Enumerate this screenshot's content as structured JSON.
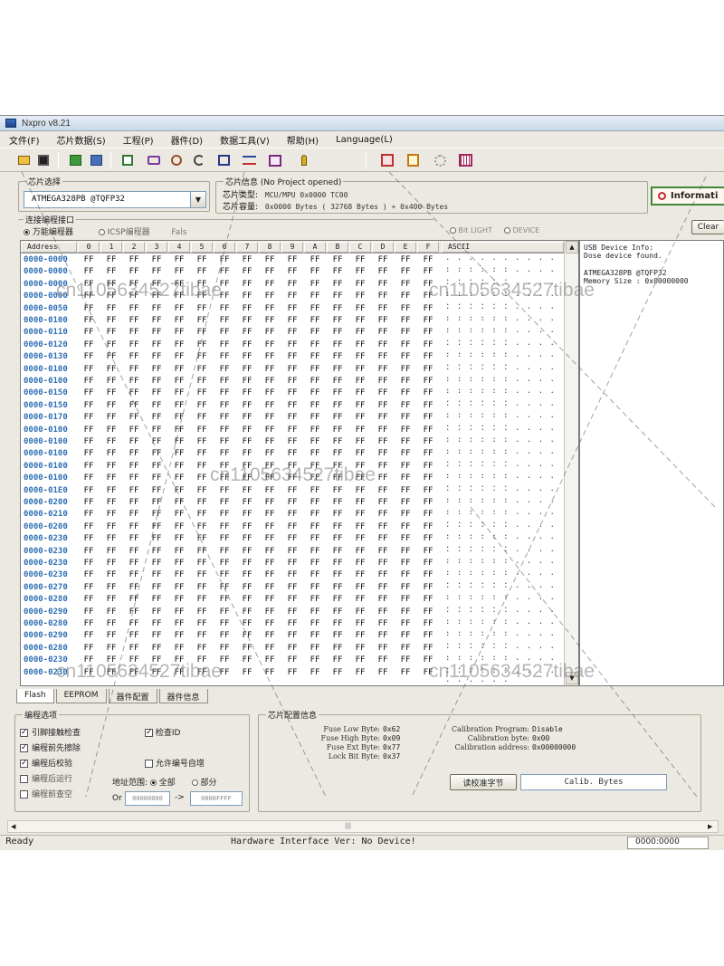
{
  "window": {
    "title": "Nxpro v8.21"
  },
  "menu": [
    "文件(F)",
    "芯片数据(S)",
    "工程(P)",
    "器件(D)",
    "数据工具(V)",
    "帮助(H)",
    "Language(L)"
  ],
  "toolbar_icons": [
    "open-icon",
    "save-icon",
    "load-project-icon",
    "save-project-icon",
    "program-icon",
    "read-icon",
    "verify-icon",
    "erase-icon",
    "blank-check-icon",
    "auto-icon",
    "lock-icon",
    "config-icon",
    "encrypt-icon",
    "memory-icon"
  ],
  "chip_select": {
    "title": "芯片选择",
    "value": "ATMEGA328PB @TQFP32"
  },
  "chip_info": {
    "title": "芯片信息 (No Project opened)",
    "type_label": "芯片类型:",
    "type_value": "MCU/MPU    0x0000 TC00",
    "size_label": "芯片容量:",
    "size_value": "0x0000 Bytes ( 32768 Bytes ) + 0x400 Bytes"
  },
  "info_button": {
    "label": "Informati"
  },
  "connection": {
    "title": "连接编程接口",
    "opt1": "万能编程器",
    "opt2": "ICSP编程器",
    "opt3": "Fals",
    "radio_a": "Bit LIGHT",
    "radio_b": "DEVICE"
  },
  "clear_label": "Clear",
  "hex": {
    "header_address": "Address",
    "header_ascii": "ASCII",
    "columns": [
      "0",
      "1",
      "2",
      "3",
      "4",
      "5",
      "6",
      "7",
      "8",
      "9",
      "A",
      "B",
      "C",
      "D",
      "E",
      "F"
    ],
    "rows": [
      {
        "addr": "0000-0000"
      },
      {
        "addr": "0000-0000"
      },
      {
        "addr": "0000-0000"
      },
      {
        "addr": "0000-0000"
      },
      {
        "addr": "0000-0050"
      },
      {
        "addr": "0000-0100"
      },
      {
        "addr": "0000-0110"
      },
      {
        "addr": "0000-0120"
      },
      {
        "addr": "0000-0130"
      },
      {
        "addr": "0000-0100"
      },
      {
        "addr": "0000-0100"
      },
      {
        "addr": "0000-0150"
      },
      {
        "addr": "0000-0150"
      },
      {
        "addr": "0000-0170"
      },
      {
        "addr": "0000-0100"
      },
      {
        "addr": "0000-0100"
      },
      {
        "addr": "0000-0100"
      },
      {
        "addr": "0000-0100"
      },
      {
        "addr": "0000-0100"
      },
      {
        "addr": "0000-01E0"
      },
      {
        "addr": "0000-0200"
      },
      {
        "addr": "0000-0210"
      },
      {
        "addr": "0000-0200"
      },
      {
        "addr": "0000-0230"
      },
      {
        "addr": "0000-0230"
      },
      {
        "addr": "0000-0230"
      },
      {
        "addr": "0000-0230"
      },
      {
        "addr": "0000-0270"
      },
      {
        "addr": "0000-0280"
      },
      {
        "addr": "0000-0290"
      },
      {
        "addr": "0000-0280"
      },
      {
        "addr": "0000-0290"
      },
      {
        "addr": "0000-0280"
      },
      {
        "addr": "0000-0230"
      },
      {
        "addr": "0000-0230"
      }
    ],
    "cell_value": "FF",
    "ascii_value": ". . . . . . . . . . . . . . . ."
  },
  "side_panel": {
    "line1": "USB Device Info:",
    "line2": "  Dose device found.",
    "line3": "ATMEGA328PB @TQFP32",
    "line4": "  Memory Size : 0x00000000"
  },
  "tabs": [
    "Flash",
    "EEPROM",
    "器件配置",
    "器件信息"
  ],
  "program_settings": {
    "title": "编程选项",
    "options": [
      {
        "label": "引脚接触检查",
        "checked": true
      },
      {
        "label": "编程前先擦除",
        "checked": true
      },
      {
        "label": "编程后校验",
        "checked": true
      },
      {
        "label": "编程后运行",
        "checked": false
      },
      {
        "label": "编程前查空",
        "checked": false
      }
    ],
    "opt_verify": "检查ID",
    "opt_serial": "允许编号自增",
    "range_label": "地址范围:",
    "range_all": "全部",
    "range_part": "部分",
    "range_or": "Or",
    "range_from": "00000000",
    "range_arrow": "->",
    "range_to": "0000FFFF"
  },
  "chip_config": {
    "title": "芯片配置信息",
    "rows_left": [
      {
        "k": "Fuse Low Byte:",
        "v": "0x62"
      },
      {
        "k": "Fuse High Byte:",
        "v": "0x09"
      },
      {
        "k": "Fuse Ext Byte:",
        "v": "0x77"
      },
      {
        "k": "Lock Bit Byte:",
        "v": "0x37"
      }
    ],
    "rows_right": [
      {
        "k": "Calibration Program:",
        "v": "Disable"
      },
      {
        "k": "Calibration byte:",
        "v": "0x00"
      },
      {
        "k": "Calibration address:",
        "v": "0x00000000"
      }
    ],
    "read_calib_button": "读校准字节",
    "calib_field": "Calib. Bytes"
  },
  "status": {
    "left": "Ready",
    "center": "Hardware Interface Ver: No Device!",
    "right": "0000:0000"
  },
  "watermark": "cn1105634527tibae"
}
